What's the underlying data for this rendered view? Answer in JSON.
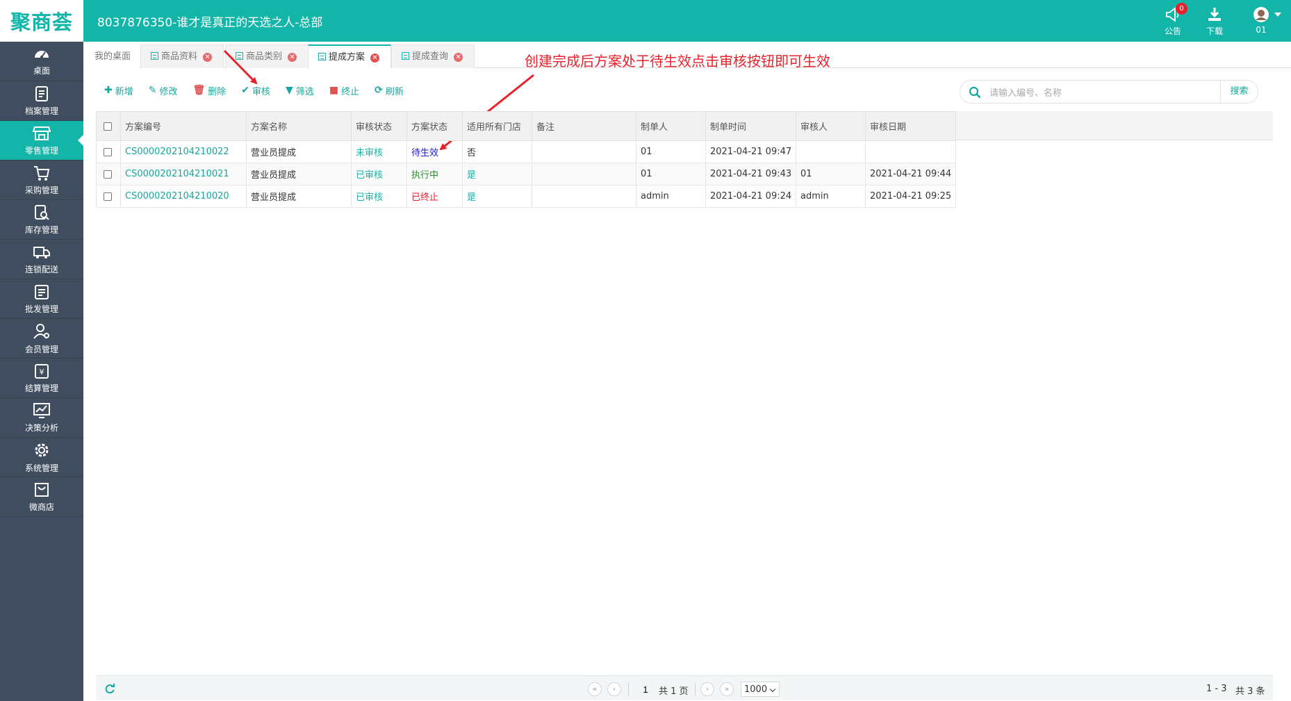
{
  "header": {
    "logo": "聚商荟",
    "title": "8037876350-谁才是真正的天选之人-总部",
    "notice_label": "公告",
    "notice_badge": "0",
    "download_label": "下载",
    "user_label": "01"
  },
  "sidebar": {
    "items": [
      {
        "label": "桌面",
        "icon": "dashboard-icon"
      },
      {
        "label": "档案管理",
        "icon": "archive-icon"
      },
      {
        "label": "零售管理",
        "icon": "store-icon",
        "active": true
      },
      {
        "label": "采购管理",
        "icon": "purchase-icon"
      },
      {
        "label": "库存管理",
        "icon": "inventory-icon"
      },
      {
        "label": "连锁配送",
        "icon": "truck-icon"
      },
      {
        "label": "批发管理",
        "icon": "wholesale-icon"
      },
      {
        "label": "会员管理",
        "icon": "member-icon"
      },
      {
        "label": "结算管理",
        "icon": "settlement-icon"
      },
      {
        "label": "决策分析",
        "icon": "chart-icon"
      },
      {
        "label": "系统管理",
        "icon": "gear-icon"
      },
      {
        "label": "微商店",
        "icon": "shop-bag-icon"
      }
    ]
  },
  "tabs": [
    {
      "label": "我的桌面"
    },
    {
      "label": "商品资料"
    },
    {
      "label": "商品类别"
    },
    {
      "label": "提成方案",
      "active": true
    },
    {
      "label": "提成查询"
    }
  ],
  "annotation": "创建完成后方案处于待生效点击审核按钮即可生效",
  "toolbar": {
    "add": "新增",
    "edit": "修改",
    "delete": "删除",
    "audit": "审核",
    "filter": "筛选",
    "stop": "终止",
    "refresh": "刷新"
  },
  "search": {
    "placeholder": "请输入编号、名称",
    "button": "搜索"
  },
  "table": {
    "columns": [
      "方案编号",
      "方案名称",
      "审核状态",
      "方案状态",
      "适用所有门店",
      "备注",
      "制单人",
      "制单时间",
      "审核人",
      "审核日期"
    ],
    "rows": [
      {
        "code": "CS0000202104210022",
        "name": "营业员提成",
        "audit_status": "未审核",
        "plan_status": "待生效",
        "all_stores": "否",
        "remark": "",
        "creator": "01",
        "created_at": "2021-04-21 09:47",
        "auditor": "",
        "audited_at": ""
      },
      {
        "code": "CS0000202104210021",
        "name": "营业员提成",
        "audit_status": "已审核",
        "plan_status": "执行中",
        "all_stores": "是",
        "remark": "",
        "creator": "01",
        "created_at": "2021-04-21 09:43",
        "auditor": "01",
        "audited_at": "2021-04-21 09:44"
      },
      {
        "code": "CS0000202104210020",
        "name": "营业员提成",
        "audit_status": "已审核",
        "plan_status": "已终止",
        "all_stores": "是",
        "remark": "",
        "creator": "admin",
        "created_at": "2021-04-21 09:24",
        "auditor": "admin",
        "audited_at": "2021-04-21 09:25"
      }
    ]
  },
  "pager": {
    "page": "1",
    "total_pages": "共 1 页",
    "page_size": "1000",
    "range": "1 - 3",
    "total": "共 3 条"
  }
}
